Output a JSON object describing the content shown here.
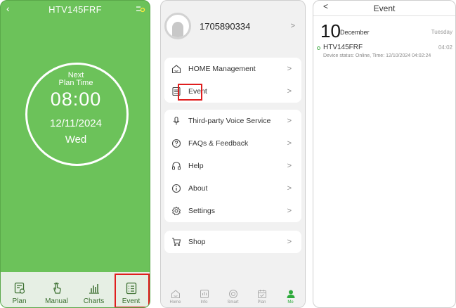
{
  "plan_screen": {
    "back_icon": "chevron-left-icon",
    "title": "HTV145FRF",
    "settings_icon": "settings-toggle-icon",
    "next_label_line1": "Next",
    "next_label_line2": "Plan Time",
    "time": "08:00",
    "date": "12/11/2024",
    "weekday": "Wed",
    "accent_color": "#6cc25a",
    "tabs": [
      {
        "label": "Plan",
        "icon": "plan-clock-icon"
      },
      {
        "label": "Manual",
        "icon": "hand-tap-icon"
      },
      {
        "label": "Charts",
        "icon": "bar-chart-icon"
      },
      {
        "label": "Event",
        "icon": "event-list-icon"
      }
    ]
  },
  "me_screen": {
    "phone_number": "1705890334",
    "chevron": ">",
    "menu_group1": [
      {
        "label": "HOME Management",
        "icon": "home-icon"
      },
      {
        "label": "Event",
        "icon": "event-list-icon"
      }
    ],
    "menu_group2": [
      {
        "label": "Third-party Voice Service",
        "icon": "microphone-icon"
      },
      {
        "label": "FAQs & Feedback",
        "icon": "question-icon"
      },
      {
        "label": "Help",
        "icon": "headset-icon"
      },
      {
        "label": "About",
        "icon": "info-icon"
      },
      {
        "label": "Settings",
        "icon": "gear-icon"
      }
    ],
    "menu_group3": [
      {
        "label": "Shop",
        "icon": "cart-icon"
      }
    ],
    "nav": [
      {
        "label": "Home",
        "icon": "home-icon"
      },
      {
        "label": "Info",
        "icon": "info-card-icon"
      },
      {
        "label": "Smart",
        "icon": "smart-icon"
      },
      {
        "label": "Plan",
        "icon": "calendar-icon"
      },
      {
        "label": "Me",
        "icon": "person-icon",
        "active": true
      }
    ],
    "active_color": "#2eaa3c"
  },
  "event_screen": {
    "back": "<",
    "title": "Event",
    "day": "10",
    "month": "December",
    "weekday": "Tuesday",
    "events": [
      {
        "device": "HTV145FRF",
        "time": "04:02",
        "detail": "Device status: Online, Time: 12/10/2024  04:02:24"
      }
    ]
  }
}
